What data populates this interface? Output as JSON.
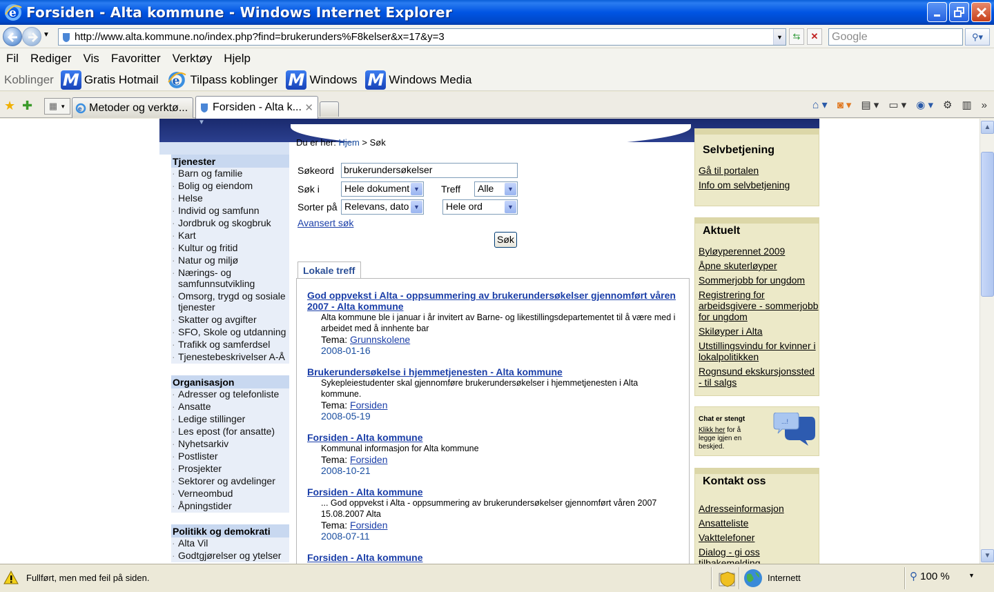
{
  "window": {
    "title": "Forsiden - Alta kommune - Windows Internet Explorer"
  },
  "address": {
    "url": "http://www.alta.kommune.no/index.php?find=brukerunders%F8kelser&x=17&y=3",
    "search_placeholder": "Google"
  },
  "menu": {
    "items": [
      "Fil",
      "Rediger",
      "Vis",
      "Favoritter",
      "Verktøy",
      "Hjelp"
    ]
  },
  "links_bar": {
    "label": "Koblinger",
    "items": [
      "Gratis Hotmail",
      "Tilpass koblinger",
      "Windows",
      "Windows Media"
    ]
  },
  "tabs": [
    {
      "label": "Metoder og verktø...",
      "active": false
    },
    {
      "label": "Forsiden - Alta k...",
      "active": true
    }
  ],
  "page": {
    "breadcrumb_prefix": "Du er her:",
    "breadcrumb_home": "Hjem",
    "breadcrumb_sep": ">",
    "breadcrumb_current": "Søk",
    "left_nav": [
      {
        "heading": "Tjenester",
        "items": [
          "Barn og familie",
          "Bolig og eiendom",
          "Helse",
          "Individ og samfunn",
          "Jordbruk og skogbruk",
          "Kart",
          "Kultur og fritid",
          "Natur og miljø",
          "Nærings- og samfunnsutvikling",
          "Omsorg, trygd og sosiale tjenester",
          "Skatter og avgifter",
          "SFO, Skole og utdanning",
          "Trafikk og samferdsel",
          "Tjenestebeskrivelser A-Å"
        ]
      },
      {
        "heading": "Organisasjon",
        "items": [
          "Adresser og telefonliste",
          "Ansatte",
          "Ledige stillinger",
          "Les epost (for ansatte)",
          "Nyhetsarkiv",
          "Postlister",
          "Prosjekter",
          "Sektorer og avdelinger",
          "Verneombud",
          "Åpningstider"
        ]
      },
      {
        "heading": "Politikk og demokrati",
        "items": [
          "Alta Vil",
          "Godtgjørelser og ytelser"
        ]
      }
    ],
    "search": {
      "keyword_label": "Søkeord",
      "keyword_value": "brukerundersøkelser",
      "search_in_label": "Søk i",
      "search_in_value": "Hele dokument",
      "hits_label": "Treff",
      "hits_value": "Alle",
      "sort_label": "Sorter på",
      "sort_value": "Relevans, dato",
      "words_value": "Hele ord",
      "advanced_link": "Avansert søk",
      "submit_label": "Søk"
    },
    "results_tab": "Lokale treff",
    "topic_label": "Tema:",
    "results": [
      {
        "title": "God oppvekst i Alta - oppsummering av brukerundersøkelser gjennomført våren 2007 - Alta kommune",
        "desc": "Alta kommune ble i januar i år invitert av Barne- og likestillingsdepartementet til å være med i arbeidet med å innhente bar",
        "topic": "Grunnskolene",
        "date": "2008-01-16"
      },
      {
        "title": "Brukerundersøkelse i hjemmetjenesten - Alta kommune",
        "desc": "Sykepleiestudenter skal gjennomføre brukerundersøkelser i hjemmetjenesten i Alta kommune.",
        "topic": "Forsiden",
        "date": "2008-05-19"
      },
      {
        "title": "Forsiden - Alta kommune",
        "desc": "Kommunal informasjon for Alta kommune",
        "topic": "Forsiden",
        "date": "2008-10-21"
      },
      {
        "title": "Forsiden - Alta kommune",
        "desc": "... God oppvekst i Alta - oppsummering av brukerundersøkelser gjennomført våren 2007 15.08.2007 Alta",
        "topic": "Forsiden",
        "date": "2008-07-11"
      },
      {
        "title": "Forsiden - Alta kommune",
        "desc": "",
        "topic": "",
        "date": ""
      }
    ],
    "right": {
      "selfservice": {
        "heading": "Selvbetjening",
        "links": [
          "Gå til portalen",
          "Info om selvbetjening"
        ]
      },
      "news": {
        "heading": "Aktuelt",
        "links": [
          "Byløyperennet 2009",
          "Åpne skuterløyper",
          "Sommerjobb for ungdom",
          "Registrering for arbeidsgivere - sommerjobb for ungdom",
          "Skiløyper i Alta",
          "Utstillingsvindu for kvinner i lokalpolitikken",
          "Rognsund ekskursjonssted - til salgs"
        ]
      },
      "chat": {
        "heading": "Chat er stengt",
        "link": "Klikk her",
        "text": "for å legge igjen en beskjed.",
        "bubble": "...!"
      },
      "contact": {
        "heading": "Kontakt oss",
        "links": [
          "Adresseinformasjon",
          "Ansatteliste",
          "Vakttelefoner",
          "Dialog - gi oss tilbakemelding"
        ]
      }
    }
  },
  "status": {
    "text": "Fullført, men med feil på siden.",
    "zone": "Internett",
    "zoom": "100 %"
  }
}
